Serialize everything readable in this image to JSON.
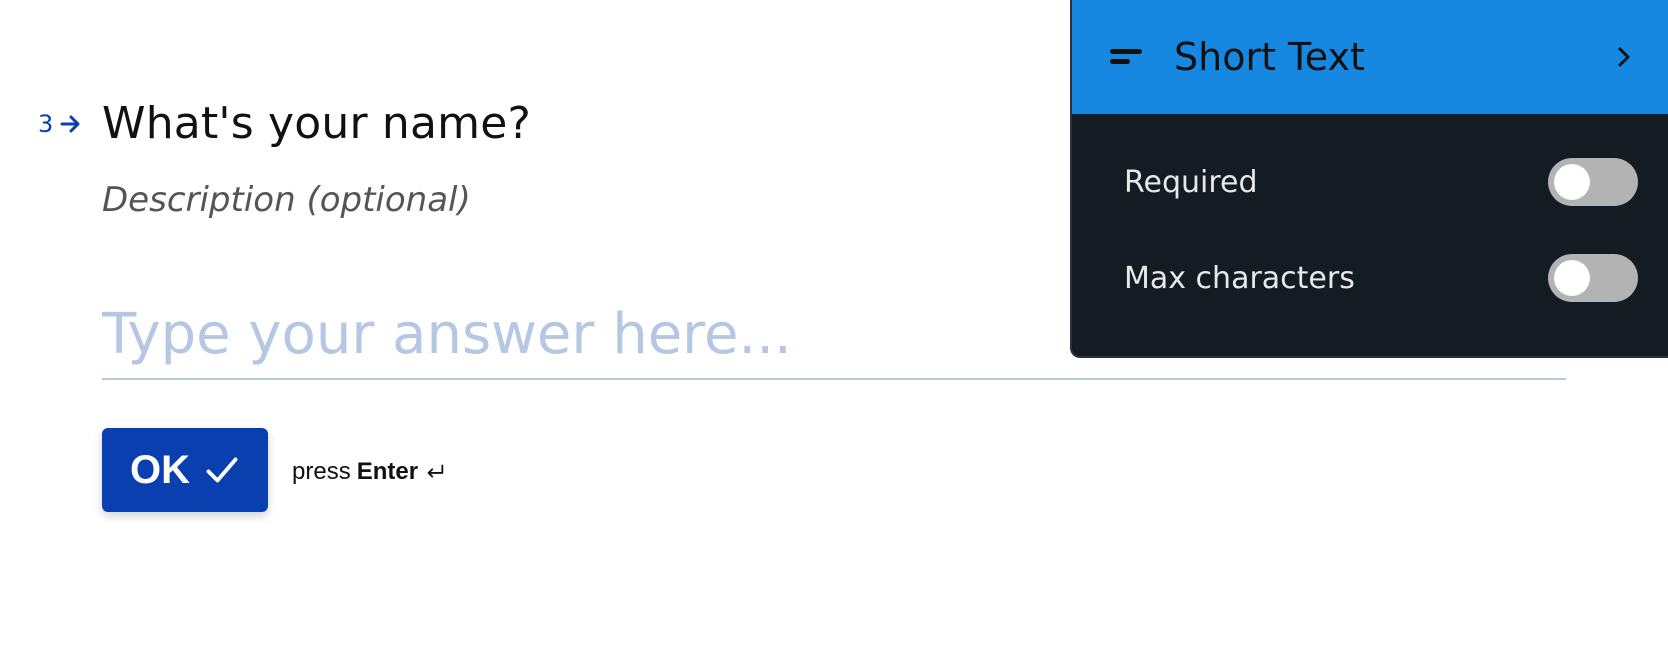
{
  "question": {
    "number": "3",
    "title": "What's your name?",
    "description": "Description (optional)",
    "answer_placeholder": "Type your answer here...",
    "ok_label": "OK",
    "hint_prefix": "press",
    "hint_key": "Enter"
  },
  "panel": {
    "type_label": "Short Text",
    "settings": [
      {
        "label": "Required",
        "enabled": false
      },
      {
        "label": "Max characters",
        "enabled": false
      }
    ]
  },
  "colors": {
    "accent_blue": "#0a3fb0",
    "panel_header": "#1688e2",
    "panel_bg": "#151b22",
    "placeholder": "#b6c7e3"
  },
  "icons": {
    "question_arrow": "arrow-right-icon",
    "ok_check": "check-icon",
    "enter": "enter-return-icon",
    "type": "short-text-icon",
    "panel_chevron": "chevron-right-icon"
  }
}
